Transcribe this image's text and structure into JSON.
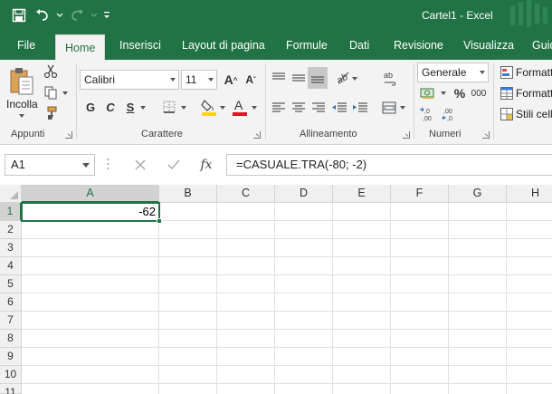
{
  "window": {
    "title": "Cartel1  -  Excel"
  },
  "tabs": [
    {
      "label": "File",
      "active": false
    },
    {
      "label": "Home",
      "active": true
    },
    {
      "label": "Inserisci",
      "active": false
    },
    {
      "label": "Layout di pagina",
      "active": false
    },
    {
      "label": "Formule",
      "active": false
    },
    {
      "label": "Dati",
      "active": false
    },
    {
      "label": "Revisione",
      "active": false
    },
    {
      "label": "Visualizza",
      "active": false
    },
    {
      "label": "Guid",
      "active": false
    }
  ],
  "ribbon": {
    "clipboard": {
      "paste_label": "Incolla",
      "group_label": "Appunti"
    },
    "font": {
      "font_name": "Calibri",
      "font_size": "11",
      "bold": "G",
      "italic": "C",
      "underline": "S",
      "group_label": "Carattere"
    },
    "alignment": {
      "group_label": "Allineamento"
    },
    "number": {
      "format": "Generale",
      "percent": "%",
      "thousands": "000",
      "group_label": "Numeri"
    },
    "styles": {
      "conditional": "Formatt",
      "table": "Formatt",
      "cell_styles": "Stili cell"
    }
  },
  "formula_bar": {
    "name_box": "A1",
    "fx": "fx",
    "formula": "=CASUALE.TRA(-80; -2)"
  },
  "sheet": {
    "columns": [
      "A",
      "B",
      "C",
      "D",
      "E",
      "F",
      "G",
      "H"
    ],
    "rows": [
      "1",
      "2",
      "3",
      "4",
      "5",
      "6",
      "7",
      "8",
      "9",
      "10",
      "11"
    ],
    "active_cell": {
      "ref": "A1",
      "value": "-62"
    }
  },
  "colors": {
    "accent": "#217346",
    "ribbon_bg": "#f3f3f3",
    "font_color_bar": "#e81123",
    "highlight_bar": "#ffd700"
  }
}
